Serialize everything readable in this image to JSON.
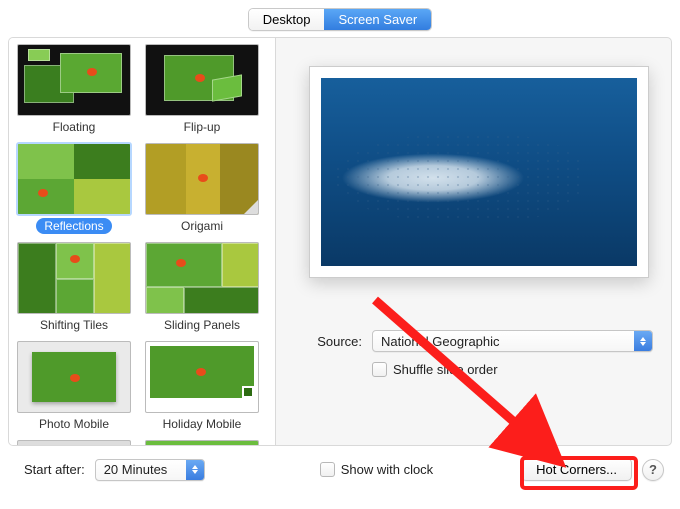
{
  "tabs": {
    "desktop": "Desktop",
    "screensaver": "Screen Saver",
    "active": "screensaver"
  },
  "screensavers": [
    {
      "label": "Floating"
    },
    {
      "label": "Flip-up"
    },
    {
      "label": "Reflections",
      "selected": true
    },
    {
      "label": "Origami"
    },
    {
      "label": "Shifting Tiles"
    },
    {
      "label": "Sliding Panels"
    },
    {
      "label": "Photo Mobile"
    },
    {
      "label": "Holiday Mobile"
    }
  ],
  "source": {
    "label": "Source:",
    "value": "National Geographic"
  },
  "shuffle": {
    "label": "Shuffle slide order",
    "checked": false
  },
  "start_after": {
    "label": "Start after:",
    "value": "20 Minutes"
  },
  "show_clock": {
    "label": "Show with clock",
    "checked": false
  },
  "hot_corners": {
    "label": "Hot Corners..."
  },
  "help": {
    "label": "?"
  },
  "annotation": {
    "highlight_target": "hot-corners-button",
    "arrow": true
  }
}
